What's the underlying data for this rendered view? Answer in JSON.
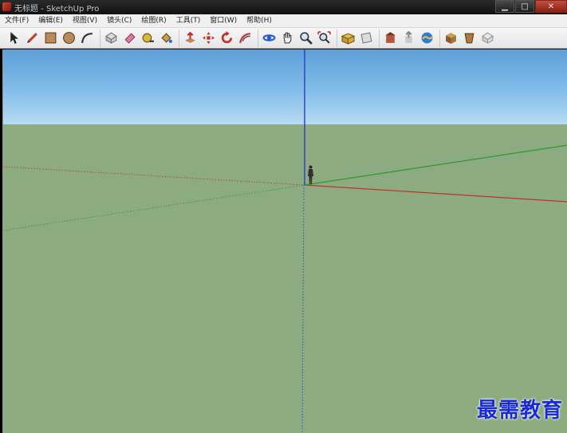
{
  "window": {
    "title": "无标题 - SketchUp Pro",
    "controls": {
      "minimize": "▁",
      "maximize": "□",
      "close": "✕"
    }
  },
  "menubar": {
    "items": [
      "文件(F)",
      "编辑(E)",
      "视图(V)",
      "镜头(C)",
      "绘图(R)",
      "工具(T)",
      "窗口(W)",
      "帮助(H)"
    ]
  },
  "toolbar": {
    "groups": [
      [
        "select-icon",
        "pencil-icon",
        "rectangle-icon",
        "circle-icon",
        "arc-icon"
      ],
      [
        "make-component-icon",
        "eraser-icon",
        "tape-measure-icon",
        "paint-bucket-icon"
      ],
      [
        "push-pull-icon",
        "move-icon",
        "rotate-icon",
        "follow-me-icon"
      ],
      [
        "orbit-icon",
        "pan-icon",
        "zoom-icon",
        "zoom-extents-icon"
      ],
      [
        "top-view-icon",
        "section-plane-icon"
      ],
      [
        "get-models-icon",
        "share-model-icon",
        "google-earth-icon"
      ],
      [
        "components-icon",
        "extension-warehouse-icon",
        "styles-icon"
      ]
    ]
  },
  "scene": {
    "colors": {
      "sky_top": "#5d9fd8",
      "sky_horizon": "#b7dbf2",
      "ground": "#8cab80",
      "red_axis": "#c0302a",
      "green_axis": "#2f9a2a",
      "blue_axis": "#2c3cc8"
    }
  },
  "watermark": {
    "text": "最需教育"
  }
}
